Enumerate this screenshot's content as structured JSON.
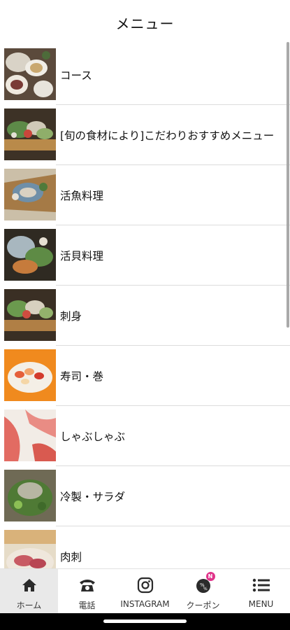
{
  "header": {
    "title": "メニュー"
  },
  "menu_items": [
    {
      "label": "コース"
    },
    {
      "label": "[旬の食材により]こだわりおすすめメニュー"
    },
    {
      "label": "活魚料理"
    },
    {
      "label": "活貝料理"
    },
    {
      "label": "刺身"
    },
    {
      "label": "寿司・巻"
    },
    {
      "label": "しゃぶしゃぶ"
    },
    {
      "label": "冷製・サラダ"
    },
    {
      "label": "肉刺"
    }
  ],
  "tabbar": {
    "tabs": [
      {
        "label": "ホーム",
        "icon": "home-icon",
        "active": true
      },
      {
        "label": "電話",
        "icon": "phone-icon",
        "active": false
      },
      {
        "label": "INSTAGRAM",
        "icon": "instagram-icon",
        "active": false
      },
      {
        "label": "クーポン",
        "icon": "coupon-icon",
        "active": false,
        "badge": "N"
      },
      {
        "label": "MENU",
        "icon": "menu-list-icon",
        "active": false
      }
    ]
  },
  "colors": {
    "badge": "#e0338a",
    "active_tab_bg": "#e9e9e9",
    "divider": "#dcdcdc"
  }
}
